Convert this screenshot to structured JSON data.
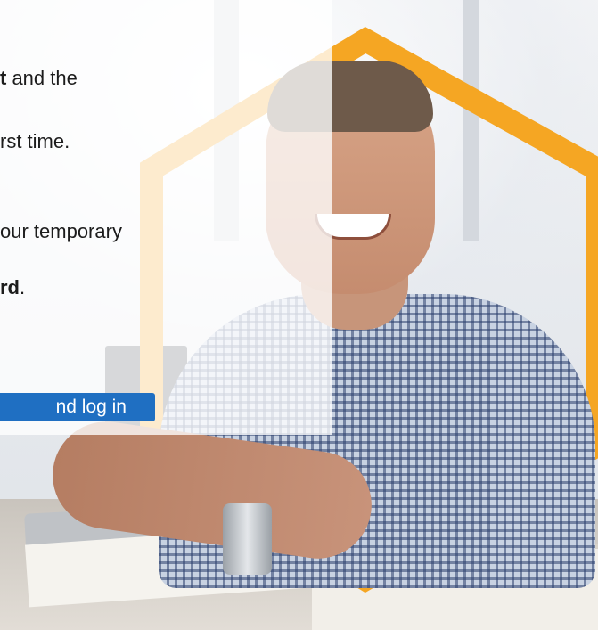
{
  "content": {
    "line1_bold": "t",
    "line1_rest": " and the",
    "line2": "rst time.",
    "line3": "our temporary",
    "line4_bold": "rd",
    "line4_rest": "."
  },
  "login_button": {
    "label": "nd log in"
  },
  "colors": {
    "accent_blue": "#1f6fc2",
    "hexagon_orange": "#f5a623"
  }
}
